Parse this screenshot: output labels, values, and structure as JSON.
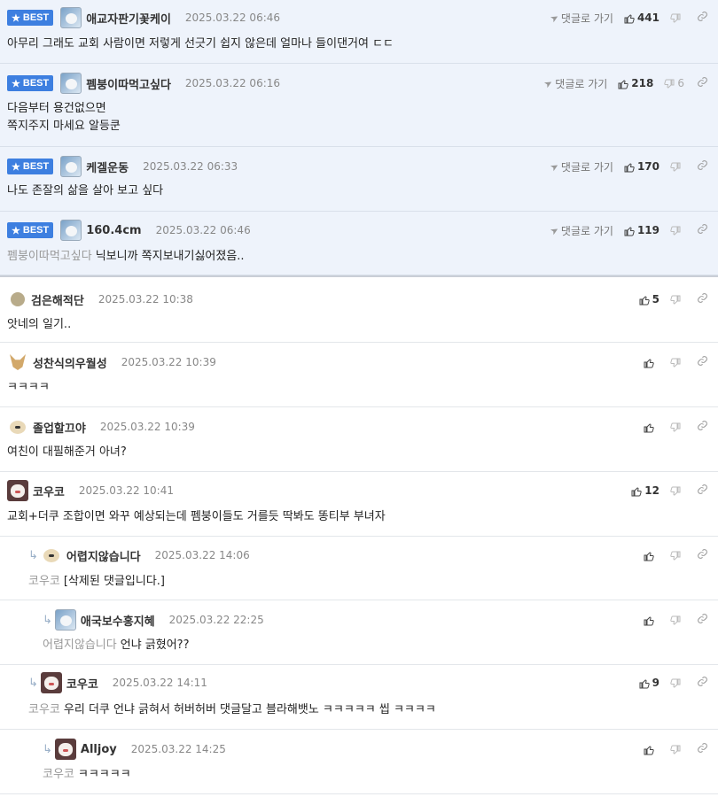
{
  "best_label": "BEST",
  "goto_label": "댓글로 가기",
  "comments": [
    {
      "nick": "애교자판기꽃케이",
      "date": "2025.03.22 06:46",
      "up": "441",
      "down": "",
      "lines": [
        "아무리 그래도 교회 사람이면 저렇게 선긋기 쉽지 않은데 얼마나 들이댄거여 ㄷㄷ"
      ],
      "mention": ""
    },
    {
      "nick": "펨붕이따먹고싶다",
      "date": "2025.03.22 06:16",
      "up": "218",
      "down": "6",
      "lines": [
        "다음부터 용건없으면",
        "쪽지주지 마세요 알등쿤"
      ],
      "mention": ""
    },
    {
      "nick": "케겔운동",
      "date": "2025.03.22 06:33",
      "up": "170",
      "down": "",
      "lines": [
        "나도 존잘의 삶을 살아 보고 싶다"
      ],
      "mention": ""
    },
    {
      "nick": "160.4cm",
      "date": "2025.03.22 06:46",
      "up": "119",
      "down": "",
      "lines": [
        "닉보니까 쪽지보내기싫어졌음.."
      ],
      "mention": "펨붕이따먹고싶다"
    },
    {
      "nick": "검은해적단",
      "date": "2025.03.22 10:38",
      "up": "5",
      "down": "",
      "lines": [
        "앗네의 일기.."
      ],
      "mention": ""
    },
    {
      "nick": "성찬식의우월성",
      "date": "2025.03.22 10:39",
      "up": "",
      "down": "",
      "lines": [
        "ㅋㅋㅋㅋ"
      ],
      "mention": ""
    },
    {
      "nick": "졸업할끄야",
      "date": "2025.03.22 10:39",
      "up": "",
      "down": "",
      "lines": [
        "여친이 대필해준거 아녀?"
      ],
      "mention": ""
    },
    {
      "nick": "코우코",
      "date": "2025.03.22 10:41",
      "up": "12",
      "down": "",
      "lines": [
        "교회+더쿠 조합이면 와꾸 예상되는데 펨붕이들도 거를듯 딱봐도 똥티부 부녀자"
      ],
      "mention": ""
    },
    {
      "nick": "어렵지않습니다",
      "date": "2025.03.22 14:06",
      "up": "",
      "down": "",
      "lines": [
        "[삭제된 댓글입니다.]"
      ],
      "mention": "코우코"
    },
    {
      "nick": "애국보수홍지혜",
      "date": "2025.03.22 22:25",
      "up": "",
      "down": "",
      "lines": [
        "언냐 긁혔어??"
      ],
      "mention": "어렵지않습니다"
    },
    {
      "nick": "코우코",
      "date": "2025.03.22 14:11",
      "up": "9",
      "down": "",
      "lines": [
        "우리 더쿠 언냐 긁혀서 허버허버 댓글달고 블라해뱃노 ㅋㅋㅋㅋㅋ 씹 ㅋㅋㅋㅋ"
      ],
      "mention": "코우코"
    },
    {
      "nick": "Alljoy",
      "date": "2025.03.22 14:25",
      "up": "",
      "down": "",
      "lines": [
        "ㅋㅋㅋㅋㅋ"
      ],
      "mention": "코우코"
    }
  ]
}
